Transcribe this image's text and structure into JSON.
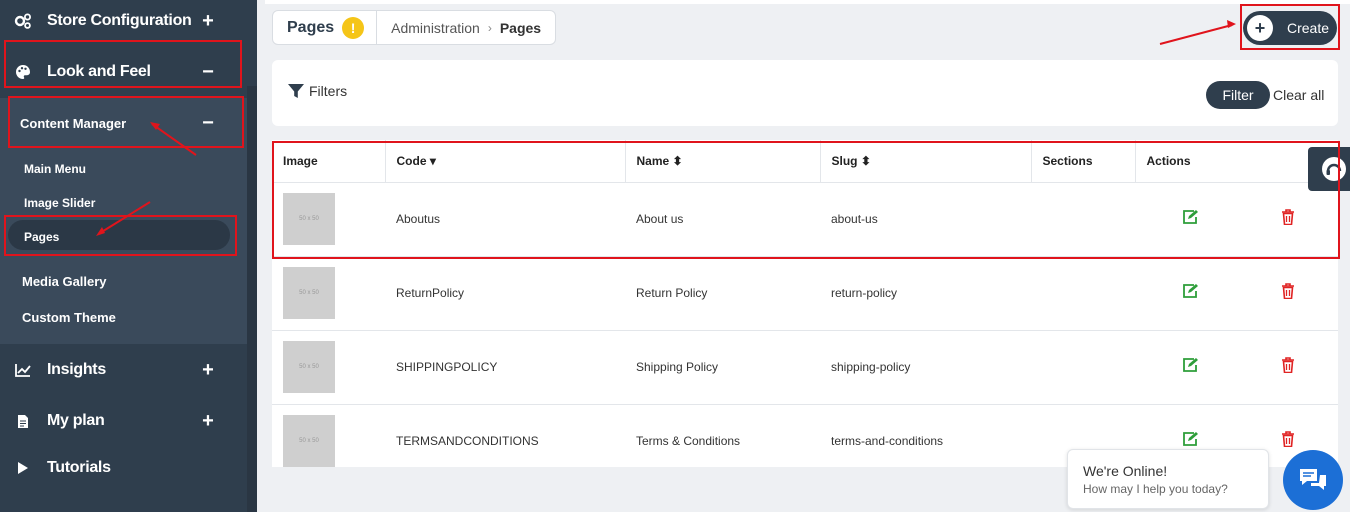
{
  "sidebar": {
    "store_config": "Store Configuration",
    "look_and_feel": "Look and Feel",
    "content_manager": "Content Manager",
    "sub_items": [
      "Main Menu",
      "Image Slider",
      "Pages"
    ],
    "media_gallery": "Media Gallery",
    "custom_theme": "Custom Theme",
    "insights": "Insights",
    "my_plan": "My plan",
    "tutorials": "Tutorials",
    "plus": "+",
    "minus": "−"
  },
  "breadcrumb": {
    "title": "Pages",
    "warning": "!",
    "parent": "Administration",
    "separator": "›",
    "current": "Pages"
  },
  "create": {
    "label": "Create",
    "icon": "+"
  },
  "filters": {
    "label": "Filters",
    "filter_button": "Filter",
    "clear_all": "Clear all"
  },
  "table": {
    "headers": [
      "Image",
      "Code ▾",
      "Name ⬍",
      "Slug ⬍",
      "Sections",
      "Actions"
    ],
    "thumb_label": "50 x 50",
    "rows": [
      {
        "code": "Aboutus",
        "name": "About us",
        "slug": "about-us"
      },
      {
        "code": "ReturnPolicy",
        "name": "Return Policy",
        "slug": "return-policy"
      },
      {
        "code": "SHIPPINGPOLICY",
        "name": "Shipping Policy",
        "slug": "shipping-policy"
      },
      {
        "code": "TERMSANDCONDITIONS",
        "name": "Terms & Conditions",
        "slug": "terms-and-conditions"
      }
    ]
  },
  "chat": {
    "title": "We're Online!",
    "subtitle": "How may I help you today?"
  },
  "colors": {
    "sidebar": "#2f3e4d",
    "annotation": "#e0141c",
    "edit": "#2e9e3a",
    "delete": "#e02424",
    "chat": "#1c6fd6"
  }
}
